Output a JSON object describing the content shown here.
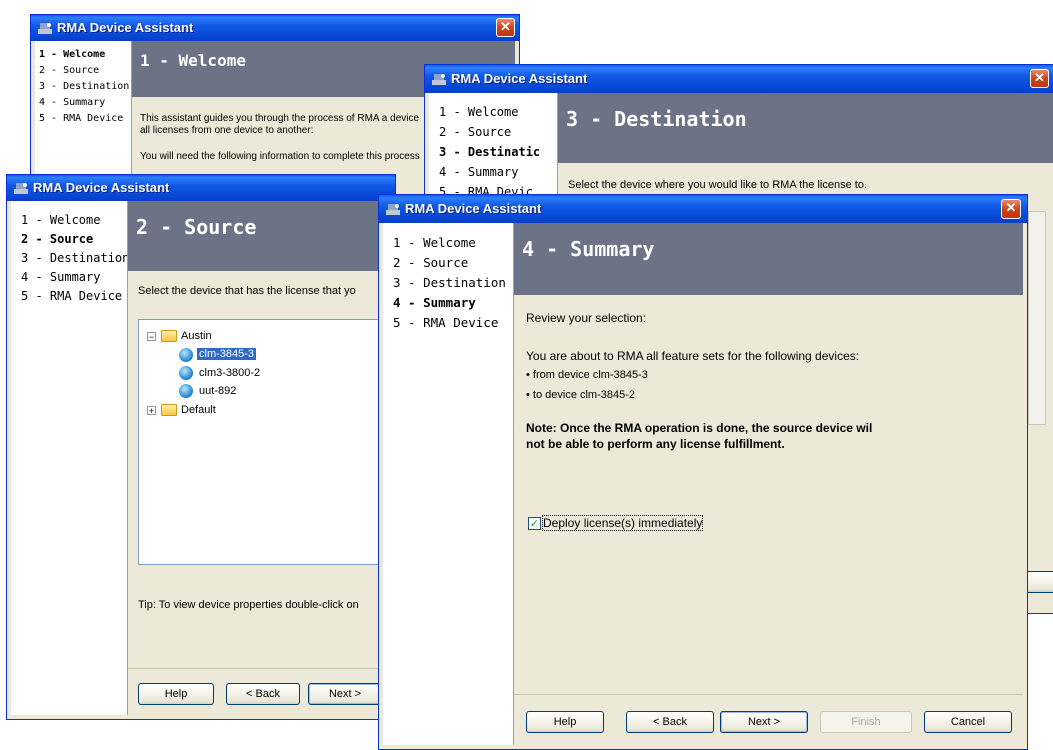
{
  "app_title": "RMA Device Assistant",
  "close_glyph": "✕",
  "steps": [
    "1 - Welcome",
    "2 - Source",
    "3 - Destination",
    "4 - Summary",
    "5 - RMA Device"
  ],
  "win3_steps": [
    "1 - Welcome",
    "2 - Source",
    "3 - Destinatic",
    "4 - Summary",
    "5 - RMA Devic"
  ],
  "welcome": {
    "header": "1 - Welcome",
    "intro_line1": "This assistant guides you through the process of RMA a device",
    "intro_line2": "all licenses from one device to another:",
    "info_line": "You will need the following information to complete this process"
  },
  "source": {
    "header": "2 - Source",
    "instruction": "Select the device that has the license that yo",
    "tree": [
      {
        "label": "Austin",
        "icon": "folder-icon",
        "expander": "minus"
      },
      {
        "label": "clm-3845-3",
        "icon": "device-icon",
        "selected": true
      },
      {
        "label": "clm3-3800-2",
        "icon": "device-icon"
      },
      {
        "label": "uut-892",
        "icon": "device-icon"
      },
      {
        "label": "Default",
        "icon": "folder-icon",
        "expander": "plus"
      }
    ],
    "tip": "Tip: To view device properties double-click on"
  },
  "destination": {
    "header": "3 - Destination",
    "instruction": "Select the device where you would like to RMA the license to."
  },
  "summary": {
    "header": "4 - Summary",
    "review": "Review your selection:",
    "about": "You are about to RMA all feature sets for the following devices:",
    "from": "• from device clm-3845-3",
    "to": "• to device clm-3845-2",
    "note_line1": "Note: Once the RMA operation is done, the source device wil",
    "note_line2": "not be able to perform any license fulfillment.",
    "deploy_label": "Deploy license(s) immediately",
    "deploy_checked": true
  },
  "buttons": {
    "help": "Help",
    "back": "< Back",
    "next": "Next >",
    "finish": "Finish",
    "cancel": "Cancel"
  },
  "colors": {
    "titlebar": "#0a5fe8",
    "header_band": "#6c7386",
    "dialog_bg": "#ece9d8",
    "selection": "#316ac5"
  }
}
